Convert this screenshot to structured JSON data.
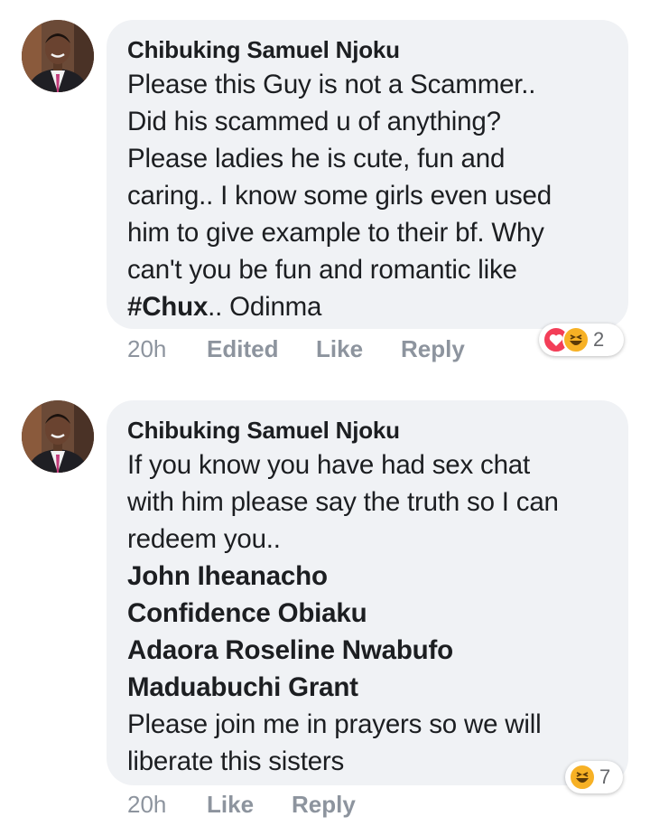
{
  "comments": [
    {
      "author": "Chibuking Samuel Njoku",
      "body_text": "Please this Guy is not a Scammer..\nDid his scammed u of anything?\nPlease ladies he is cute, fun and\ncaring.. I know some girls even used\nhim to give example to their bf. Why\ncan't you be fun and romantic like\n",
      "hashtag": "#Chux",
      "body_tail": ".. Odinma",
      "time": "20h",
      "edited": "Edited",
      "like": "Like",
      "reply": "Reply",
      "reactions": [
        "love-icon",
        "haha-icon"
      ],
      "reaction_count": "2"
    },
    {
      "author": "Chibuking Samuel Njoku",
      "body_text": "If you know you have had sex chat\nwith him please say the truth so I can\nredeem you..",
      "mentions": [
        "John Iheanacho",
        "Confidence Obiaku",
        "Adaora Roseline Nwabufo",
        "Maduabuchi Grant"
      ],
      "body_end": "Please join me in prayers so we will\nliberate this sisters",
      "time": "20h",
      "like": "Like",
      "reply": "Reply",
      "reactions": [
        "haha-icon"
      ],
      "reaction_count": "7"
    }
  ],
  "colors": {
    "bubble": "#f0f2f5",
    "text": "#1c1e21",
    "meta": "#8d949e",
    "love": "#f33e58",
    "haha": "#f7b125"
  }
}
